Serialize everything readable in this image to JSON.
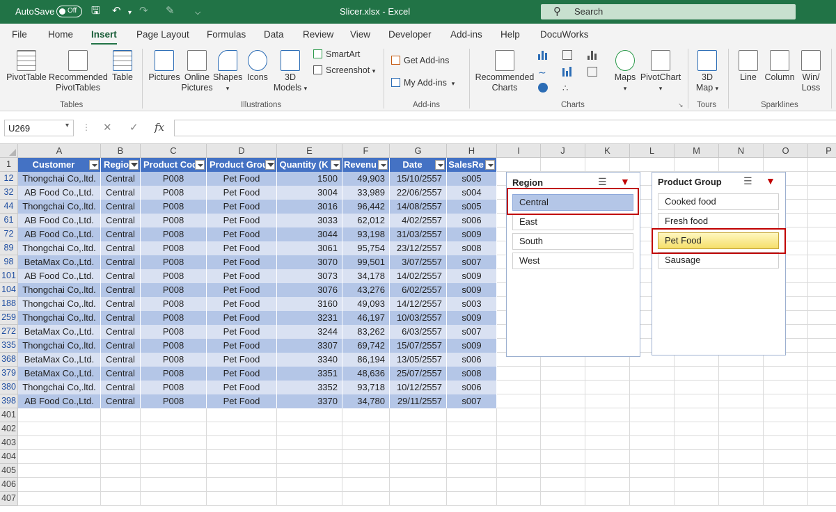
{
  "titlebar": {
    "autosave_label": "AutoSave",
    "autosave_state": "Off",
    "doc_title": "Slicer.xlsx  -  Excel",
    "search_placeholder": "Search"
  },
  "tabs": [
    "File",
    "Home",
    "Insert",
    "Page Layout",
    "Formulas",
    "Data",
    "Review",
    "View",
    "Developer",
    "Add-ins",
    "Help",
    "DocuWorks"
  ],
  "active_tab": "Insert",
  "ribbon": {
    "tables": {
      "pivottable": "PivotTable",
      "recommended_1": "Recommended",
      "recommended_2": "PivotTables",
      "table": "Table",
      "group": "Tables"
    },
    "illustrations": {
      "pictures": "Pictures",
      "online_1": "Online",
      "online_2": "Pictures",
      "shapes": "Shapes",
      "icons": "Icons",
      "models_1": "3D",
      "models_2": "Models",
      "smartart": "SmartArt",
      "screenshot": "Screenshot",
      "group": "Illustrations"
    },
    "addins": {
      "get": "Get Add-ins",
      "my": "My Add-ins",
      "group": "Add-ins"
    },
    "charts": {
      "rec_1": "Recommended",
      "rec_2": "Charts",
      "maps": "Maps",
      "pivotchart": "PivotChart",
      "group": "Charts"
    },
    "tours": {
      "map_1": "3D",
      "map_2": "Map",
      "group": "Tours"
    },
    "sparklines": {
      "line": "Line",
      "column": "Column",
      "winloss_1": "Win/",
      "winloss_2": "Loss",
      "group": "Sparklines"
    }
  },
  "formula_bar": {
    "name_box": "U269",
    "fx": "fx",
    "formula": ""
  },
  "columns": [
    "A",
    "B",
    "C",
    "D",
    "E",
    "F",
    "G",
    "H",
    "I",
    "J",
    "K",
    "L",
    "M",
    "N",
    "O",
    "P"
  ],
  "table_headers": [
    "Customer",
    "Regio",
    "Product Cod",
    "Product Grou",
    "Quantity (K",
    "Revenu",
    "Date",
    "SalesRe"
  ],
  "rows": [
    {
      "n": "12",
      "cells": [
        "Thongchai Co,.ltd.",
        "Central",
        "P008",
        "Pet Food",
        "1500",
        "49,903",
        "15/10/2557",
        "s005"
      ]
    },
    {
      "n": "32",
      "cells": [
        "AB Food Co.,Ltd.",
        "Central",
        "P008",
        "Pet Food",
        "3004",
        "33,989",
        "22/06/2557",
        "s004"
      ]
    },
    {
      "n": "44",
      "cells": [
        "Thongchai Co,.ltd.",
        "Central",
        "P008",
        "Pet Food",
        "3016",
        "96,442",
        "14/08/2557",
        "s005"
      ]
    },
    {
      "n": "61",
      "cells": [
        "AB Food Co.,Ltd.",
        "Central",
        "P008",
        "Pet Food",
        "3033",
        "62,012",
        "4/02/2557",
        "s006"
      ]
    },
    {
      "n": "72",
      "cells": [
        "AB Food Co.,Ltd.",
        "Central",
        "P008",
        "Pet Food",
        "3044",
        "93,198",
        "31/03/2557",
        "s009"
      ]
    },
    {
      "n": "89",
      "cells": [
        "Thongchai Co,.ltd.",
        "Central",
        "P008",
        "Pet Food",
        "3061",
        "95,754",
        "23/12/2557",
        "s008"
      ]
    },
    {
      "n": "98",
      "cells": [
        "BetaMax Co.,Ltd.",
        "Central",
        "P008",
        "Pet Food",
        "3070",
        "99,501",
        "3/07/2557",
        "s007"
      ]
    },
    {
      "n": "101",
      "cells": [
        "AB Food Co.,Ltd.",
        "Central",
        "P008",
        "Pet Food",
        "3073",
        "34,178",
        "14/02/2557",
        "s009"
      ]
    },
    {
      "n": "104",
      "cells": [
        "Thongchai Co,.ltd.",
        "Central",
        "P008",
        "Pet Food",
        "3076",
        "43,276",
        "6/02/2557",
        "s009"
      ]
    },
    {
      "n": "188",
      "cells": [
        "Thongchai Co,.ltd.",
        "Central",
        "P008",
        "Pet Food",
        "3160",
        "49,093",
        "14/12/2557",
        "s003"
      ]
    },
    {
      "n": "259",
      "cells": [
        "Thongchai Co,.ltd.",
        "Central",
        "P008",
        "Pet Food",
        "3231",
        "46,197",
        "10/03/2557",
        "s009"
      ]
    },
    {
      "n": "272",
      "cells": [
        "BetaMax Co.,Ltd.",
        "Central",
        "P008",
        "Pet Food",
        "3244",
        "83,262",
        "6/03/2557",
        "s007"
      ]
    },
    {
      "n": "335",
      "cells": [
        "Thongchai Co,.ltd.",
        "Central",
        "P008",
        "Pet Food",
        "3307",
        "69,742",
        "15/07/2557",
        "s009"
      ]
    },
    {
      "n": "368",
      "cells": [
        "BetaMax Co.,Ltd.",
        "Central",
        "P008",
        "Pet Food",
        "3340",
        "86,194",
        "13/05/2557",
        "s006"
      ]
    },
    {
      "n": "379",
      "cells": [
        "BetaMax Co.,Ltd.",
        "Central",
        "P008",
        "Pet Food",
        "3351",
        "48,636",
        "25/07/2557",
        "s008"
      ]
    },
    {
      "n": "380",
      "cells": [
        "Thongchai Co,.ltd.",
        "Central",
        "P008",
        "Pet Food",
        "3352",
        "93,718",
        "10/12/2557",
        "s006"
      ]
    },
    {
      "n": "398",
      "cells": [
        "AB Food Co.,Ltd.",
        "Central",
        "P008",
        "Pet Food",
        "3370",
        "34,780",
        "29/11/2557",
        "s007"
      ]
    }
  ],
  "empty_rows": [
    "401",
    "402",
    "403",
    "404",
    "405",
    "406",
    "407"
  ],
  "slicer_region": {
    "title": "Region",
    "items": [
      "Central",
      "East",
      "South",
      "West"
    ],
    "selected": "Central"
  },
  "slicer_product": {
    "title": "Product Group",
    "items": [
      "Cooked food",
      "Fresh food",
      "Pet Food",
      "Sausage"
    ],
    "selected": "Pet Food"
  },
  "colors": {
    "excel_green": "#217346",
    "table_header": "#4472c4",
    "band_dark": "#b4c6e7",
    "band_light": "#d9e1f2",
    "highlight": "#c00000"
  }
}
